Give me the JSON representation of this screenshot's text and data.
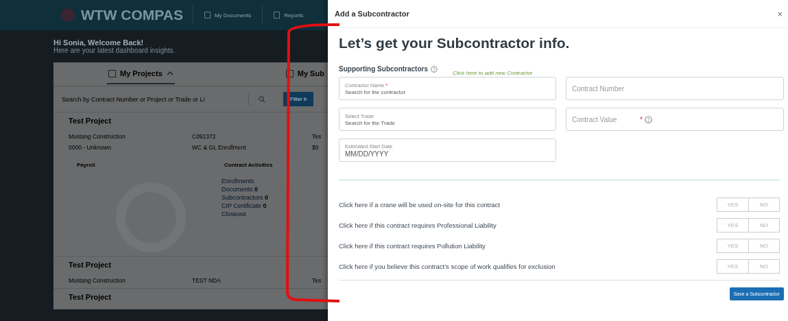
{
  "background": {
    "brand": "WTW COMPAS",
    "nav": [
      "My Documents",
      "Reports"
    ],
    "greeting": "Hi Sonia, Welcome Back!",
    "subtitle": "Here are your latest dashboard insights.",
    "tabs": [
      {
        "label": "My Projects",
        "selected": true
      },
      {
        "label": "My Sub",
        "selected": false
      }
    ],
    "search": {
      "placeholder": "Search by Contract Number or Project or Trade or Li"
    },
    "filter_button": "Filter b",
    "projects": [
      {
        "title": "Test Project",
        "values": [
          "Mustang Construction",
          "C091372",
          "Tes"
        ],
        "values_2": [
          "0000 - Unknown",
          "WC & GL Enrollment",
          "$0"
        ],
        "expanded": true
      },
      {
        "title": "Test Project",
        "values": [
          "Mustang Construction",
          "TEST NDA",
          "Tes"
        ],
        "expanded": false
      },
      {
        "title": "Test Project",
        "expanded": false
      }
    ],
    "payroll_title": "Payroll",
    "activities_title": "Contract Activities",
    "activities": [
      {
        "label": "Enrollments"
      },
      {
        "label": "Documents",
        "count": "0"
      },
      {
        "label": "Subcontractors",
        "count": "0"
      },
      {
        "label": "CIP Certificate",
        "count": "0"
      },
      {
        "label": "Closeout"
      }
    ]
  },
  "dialog": {
    "title": "Add a Subcontractor",
    "close": "×",
    "heading": "Let’s get your Subcontractor info.",
    "section": "Supporting Subcontractors",
    "add_link": "Click here to add new Contractor",
    "fields": [
      {
        "kind": "labeled",
        "label": "Contractor Name",
        "mark": "*",
        "placeholder": "Search for the contractor"
      },
      {
        "kind": "plain",
        "placeholder": "Contract Number"
      },
      {
        "kind": "labeled",
        "label": "Select Trade",
        "placeholder": "Search for the Trade"
      },
      {
        "kind": "plain",
        "placeholder": "Contract Value",
        "mark": "*",
        "help": true
      },
      {
        "kind": "labeled",
        "label": "Estimated Start Date",
        "placeholder": "MM/DD/YYYY"
      }
    ],
    "questions": [
      {
        "text": "Click here if a crane will be used on-site for this contract",
        "options": [
          {
            "label": "YES",
            "selected": false
          },
          {
            "label": "NO",
            "selected": false
          }
        ]
      },
      {
        "text": "Click here if this contract requires Professional Liability",
        "options": [
          {
            "label": "YES",
            "selected": false
          },
          {
            "label": "NO",
            "selected": false
          }
        ]
      },
      {
        "text": "Click here if this contract requires Pollution Liability",
        "options": [
          {
            "label": "YES",
            "selected": false
          },
          {
            "label": "NO",
            "selected": false
          }
        ]
      },
      {
        "text": "Click here if you believe this contract’s scope of work qualifies for exclusion",
        "options": [
          {
            "label": "YES",
            "selected": false
          },
          {
            "label": "NO",
            "selected": false
          }
        ]
      }
    ],
    "save_button": "Save a Subcontractor"
  }
}
